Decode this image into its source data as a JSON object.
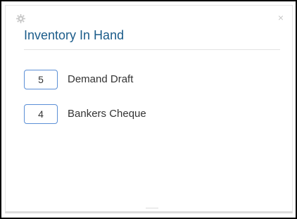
{
  "widget": {
    "title": "Inventory In Hand",
    "close_label": "×",
    "settings_icon": "gear-icon",
    "accent_color": "#1b5c8a",
    "border_color": "#5b8fd6"
  },
  "items": [
    {
      "count": "5",
      "label": "Demand Draft"
    },
    {
      "count": "4",
      "label": "Bankers Cheque"
    }
  ]
}
